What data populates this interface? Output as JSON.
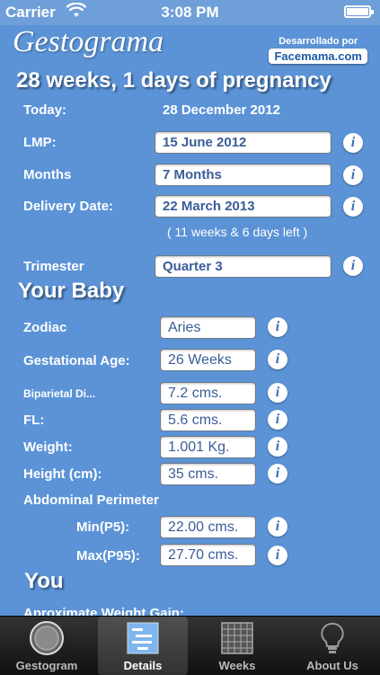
{
  "status": {
    "carrier": "Carrier",
    "time": "3:08 PM"
  },
  "app": {
    "title": "Gestograma",
    "credit": "Desarrollado por",
    "brand": "Facemama.com"
  },
  "headline": "28 weeks, 1 days of pregnancy",
  "today": {
    "label": "Today:",
    "value": "28 December 2012"
  },
  "lmp": {
    "label": "LMP:",
    "value": "15 June 2012"
  },
  "months": {
    "label": "Months",
    "value": "7 Months"
  },
  "delivery": {
    "label": "Delivery Date:",
    "value": "22 March 2013",
    "note": "( 11 weeks & 6 days left )"
  },
  "trimester": {
    "label": "Trimester",
    "value": "Quarter 3"
  },
  "baby": {
    "title": "Your Baby",
    "zodiac": {
      "label": "Zodiac",
      "value": "Aries"
    },
    "gest_age": {
      "label": "Gestational Age:",
      "value": "26 Weeks"
    },
    "biparietal": {
      "label": "Biparietal Di...",
      "value": "7.2 cms."
    },
    "fl": {
      "label": "FL:",
      "value": "5.6 cms."
    },
    "weight": {
      "label": "Weight:",
      "value": "1.001 Kg."
    },
    "height": {
      "label": "Height (cm):",
      "value": "35 cms."
    },
    "abdominal": {
      "label": "Abdominal Perimeter",
      "min_label": "Min(P5):",
      "min_value": "22.00  cms.",
      "max_label": "Max(P95):",
      "max_value": "27.70  cms."
    }
  },
  "you": {
    "title": "You",
    "weight_gain_label": "Aproximate Weight Gain:"
  },
  "info_glyph": "i",
  "tabs": [
    {
      "label": "Gestogram",
      "icon": "dial-icon"
    },
    {
      "label": "Details",
      "icon": "list-icon"
    },
    {
      "label": "Weeks",
      "icon": "calendar-icon"
    },
    {
      "label": "About Us",
      "icon": "lightbulb-icon"
    }
  ]
}
